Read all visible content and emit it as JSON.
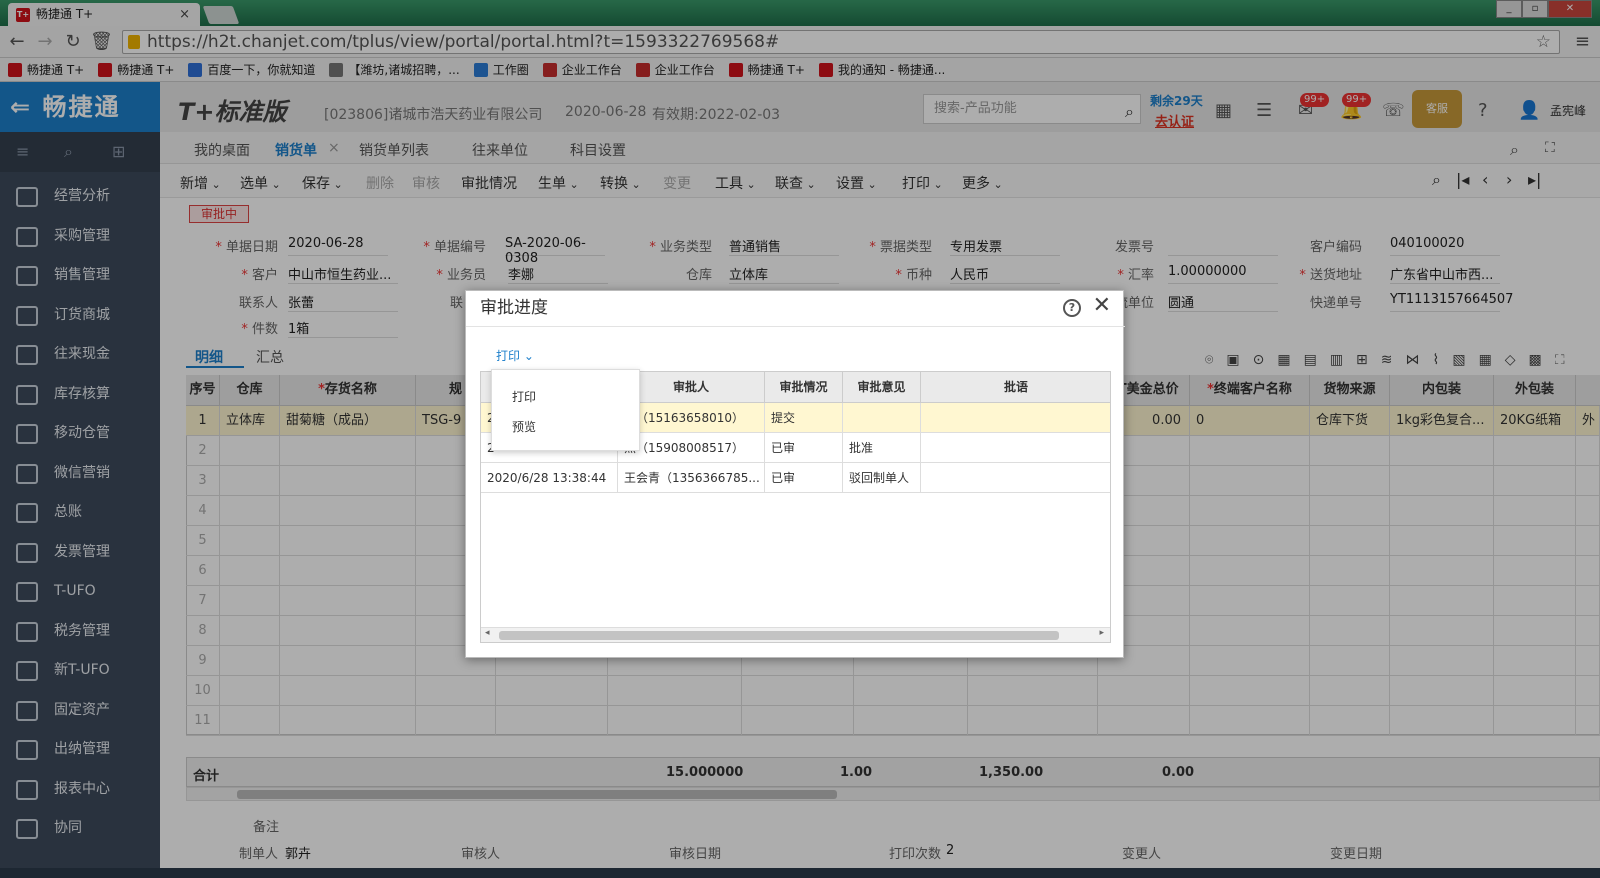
{
  "browser": {
    "tab_title": "畅捷通 T+",
    "tab_close": "×",
    "url": "https://h2t.chanjet.com/tplus/view/portal/portal.html?t=1593322769568#",
    "bookmarks": [
      "畅捷通 T+",
      "畅捷通 T+",
      "百度一下，你就知道",
      "【潍坊,诸城招聘，...",
      "工作圈",
      "企业工作台",
      "企业工作台",
      "畅捷通 T+",
      "我的通知 - 畅捷通..."
    ]
  },
  "header": {
    "logo": "⇐ 畅捷通",
    "product": "T+标准版",
    "company": "[023806]诸城市浩天药业有限公司",
    "date": "2020-06-28",
    "expire": "有效期:2022-02-03",
    "search_placeholder": "搜索-产品功能",
    "remain": "剩余29天",
    "certify": "去认证",
    "badge1": "99+",
    "badge2": "99+",
    "kefu": "客服",
    "user": "孟宪峰"
  },
  "sidebar": {
    "items": [
      "经营分析",
      "采购管理",
      "销售管理",
      "订货商城",
      "往来现金",
      "库存核算",
      "移动仓管",
      "微信营销",
      "总账",
      "发票管理",
      "T-UFO",
      "税务管理",
      "新T-UFO",
      "固定资产",
      "出纳管理",
      "报表中心",
      "协同"
    ]
  },
  "page_tabs": [
    "我的桌面",
    "销货单",
    "销货单列表",
    "往来单位",
    "科目设置"
  ],
  "toolbar": [
    "新增",
    "选单",
    "保存",
    "删除",
    "审核",
    "审批情况",
    "生单",
    "转换",
    "变更",
    "工具",
    "联查",
    "设置",
    "打印",
    "更多"
  ],
  "doc": {
    "status": "审批中",
    "fields": {
      "date_label": "单据日期",
      "date": "2020-06-28",
      "no_label": "单据编号",
      "no": "SA-2020-06-0308",
      "biztype_label": "业务类型",
      "biztype": "普通销售",
      "invtype_label": "票据类型",
      "invtype": "专用发票",
      "invno_label": "发票号",
      "invno": "",
      "custcode_label": "客户编码",
      "custcode": "040100020",
      "cust_label": "客户",
      "cust": "中山市恒生药业...",
      "salesman_label": "业务员",
      "salesman": "李娜",
      "wh_label": "仓库",
      "wh": "立体库",
      "cur_label": "币种",
      "cur": "人民币",
      "rate_label": "汇率",
      "rate": "1.00000000",
      "addr_label": "送货地址",
      "addr": "广东省中山市西...",
      "contact_label": "联系人",
      "contact": "张蕾",
      "contact2_label": "联",
      "logistics_label": "流单位",
      "logistics": "圆通",
      "express_label": "快递单号",
      "express": "YT1113157664507",
      "pieces_label": "件数",
      "pieces": "1箱"
    }
  },
  "detail_tabs": [
    "明细",
    "汇总"
  ],
  "grid": {
    "headers": [
      "序号",
      "仓库",
      "存货名称",
      "规",
      "ST美金总价",
      "终端客户名称",
      "货物来源",
      "内包装",
      "外包装"
    ],
    "row1": {
      "no": "1",
      "wh": "立体库",
      "name": "甜菊糖（成品）",
      "spec": "TSG-9",
      "usd": "0.00",
      "client": "0",
      "source": "仓库下货",
      "inner": "1kg彩色复合...",
      "outer": "20KG纸箱",
      "extra": "外"
    },
    "row_numbers": [
      "2",
      "3",
      "4",
      "5",
      "6",
      "7",
      "8",
      "9",
      "10",
      "11"
    ],
    "total_label": "合计",
    "totals": [
      "15.000000",
      "1.00",
      "1,350.00",
      "0.00"
    ]
  },
  "footer": {
    "remark_label": "备注",
    "maker_label": "制单人",
    "maker": "郭卉",
    "auditor_label": "审核人",
    "audit_date_label": "审核日期",
    "print_count_label": "打印次数",
    "print_count": "2",
    "changer_label": "变更人",
    "change_date_label": "变更日期"
  },
  "dialog": {
    "title": "审批进度",
    "help": "?",
    "close": "✕",
    "print_menu": "打印",
    "menu_items": [
      "打印",
      "预览"
    ],
    "headers": [
      "审批人",
      "审批情况",
      "审批意见",
      "批语"
    ],
    "rows": [
      {
        "time": "2",
        "approver": "卉（15163658010）",
        "status": "提交",
        "opinion": "",
        "comment": ""
      },
      {
        "time": "2",
        "approver": "杰（15908008517）",
        "status": "已审",
        "opinion": "批准",
        "comment": ""
      },
      {
        "time": "2020/6/28 13:38:44",
        "approver": "王会青（1356366785...",
        "status": "已审",
        "opinion": "驳回制单人",
        "comment": ""
      }
    ]
  }
}
